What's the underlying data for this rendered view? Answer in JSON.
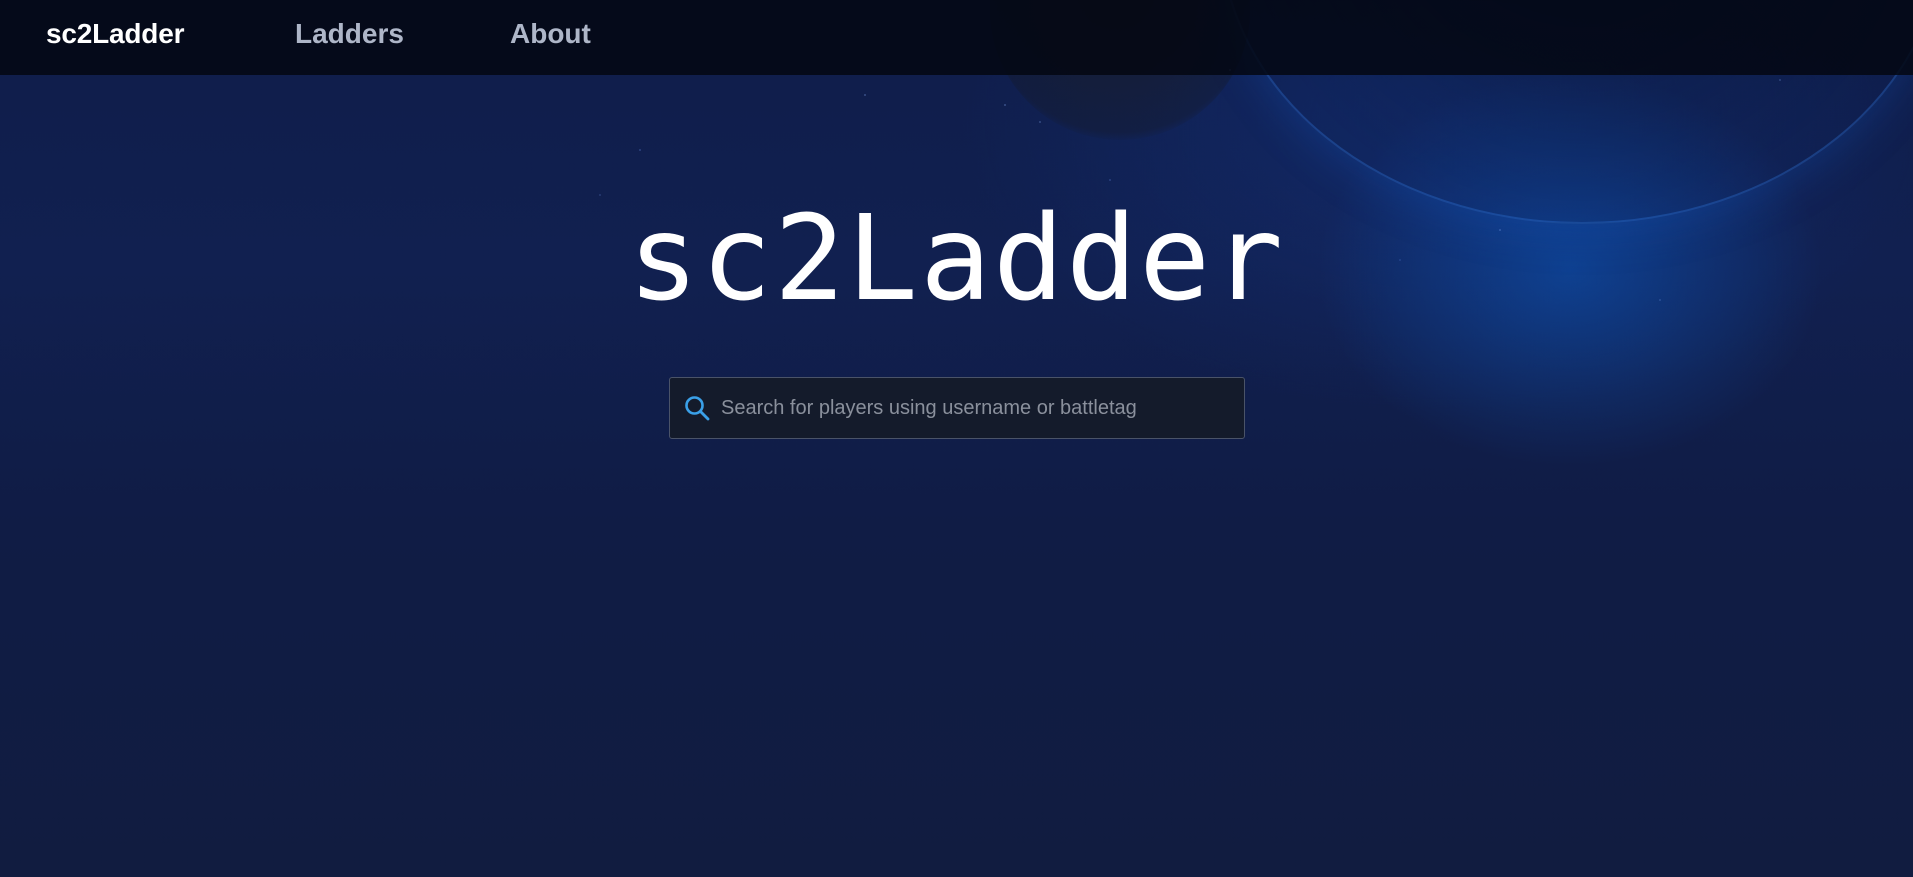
{
  "navbar": {
    "brand": "sc2Ladder",
    "links": [
      {
        "label": "Ladders"
      },
      {
        "label": "About"
      }
    ]
  },
  "hero": {
    "logo_text": "sc2Ladder"
  },
  "search": {
    "placeholder": "Search for players using username or battletag",
    "value": "",
    "icon": "search-icon"
  },
  "colors": {
    "accent": "#3aa0e8",
    "navbar_bg": "#04070f",
    "page_bg": "#111c40"
  }
}
